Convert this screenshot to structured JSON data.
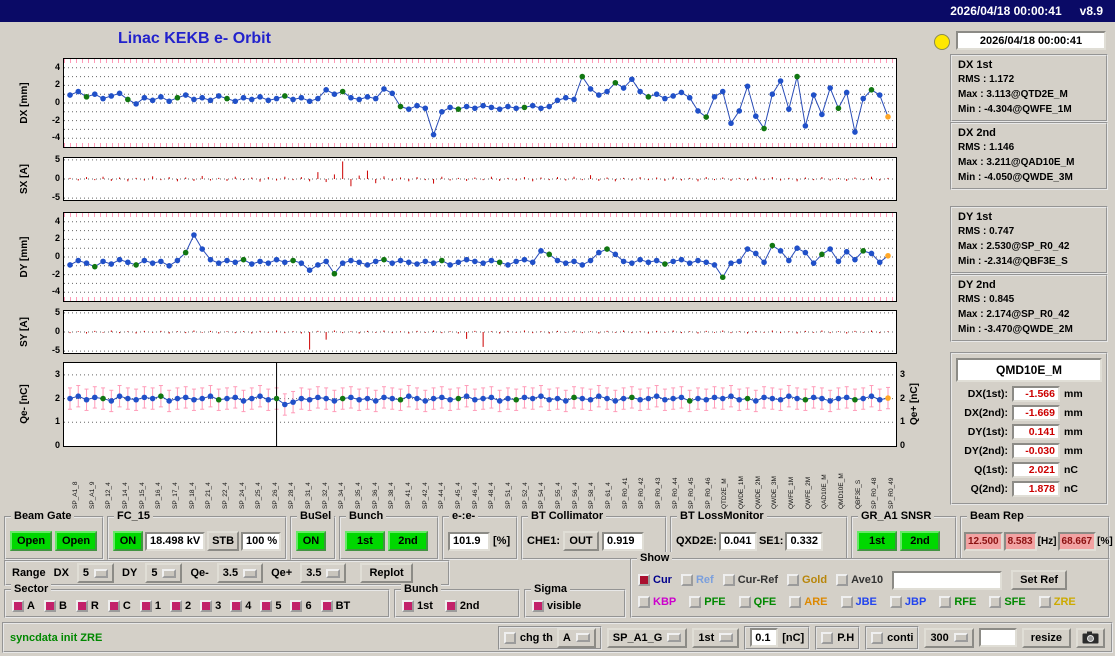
{
  "topbar": {
    "datetime": "2026/04/18 00:00:41",
    "version": "v8.9"
  },
  "title": "Linac KEKB e- Orbit",
  "status": {
    "timestamp": "2026/04/18 00:00:41",
    "stats": [
      {
        "name": "DX 1st",
        "lines": [
          "RMS : 1.172",
          "Max : 3.113@QTD2E_M",
          "Min : -4.304@QWFE_1M"
        ]
      },
      {
        "name": "DX 2nd",
        "lines": [
          "RMS : 1.146",
          "Max : 3.211@QAD10E_M",
          "Min : -4.050@QWDE_3M"
        ]
      },
      {
        "name": "DY 1st",
        "lines": [
          "RMS : 0.747",
          "Max : 2.530@SP_R0_42",
          "Min : -2.314@QBF3E_S"
        ]
      },
      {
        "name": "DY 2nd",
        "lines": [
          "RMS : 0.845",
          "Max : 2.174@SP_R0_42",
          "Min : -3.470@QWDE_2M"
        ]
      }
    ],
    "monitor": {
      "title": "QMD10E_M",
      "rows": [
        {
          "label": "DX(1st):",
          "value": "-1.566",
          "unit": "mm"
        },
        {
          "label": "DX(2nd):",
          "value": "-1.669",
          "unit": "mm"
        },
        {
          "label": "DY(1st):",
          "value": "0.141",
          "unit": "mm"
        },
        {
          "label": "DY(2nd):",
          "value": "-0.030",
          "unit": "mm"
        },
        {
          "label": "Q(1st):",
          "value": "2.021",
          "unit": "nC"
        },
        {
          "label": "Q(2nd):",
          "value": "1.878",
          "unit": "nC"
        }
      ]
    }
  },
  "chart_data": [
    {
      "type": "line",
      "ylabel": "DX [mm]",
      "ymin": -5,
      "ymax": 5,
      "ticks": [
        4,
        2,
        0,
        -2,
        -4
      ],
      "grid": [
        4,
        3,
        2,
        1,
        0,
        -1,
        -2,
        -3,
        -4
      ],
      "point_color": "#2050c8",
      "alt_point_color": "#117711",
      "line_color": "#2a4db8",
      "end_color": "#ffa726",
      "end_orange": true,
      "values": [
        0.9,
        1.3,
        0.7,
        1.0,
        0.5,
        0.8,
        1.1,
        0.4,
        -0.1,
        0.6,
        0.3,
        0.7,
        0.2,
        0.6,
        0.9,
        0.4,
        0.6,
        0.3,
        0.8,
        0.5,
        0.2,
        0.6,
        0.4,
        0.7,
        0.3,
        0.5,
        0.8,
        0.4,
        0.6,
        0.2,
        0.5,
        1.5,
        1.0,
        1.3,
        0.6,
        0.4,
        0.7,
        0.5,
        1.6,
        1.1,
        -0.4,
        -0.7,
        -0.3,
        -0.6,
        -3.6,
        -1.0,
        -0.5,
        -0.7,
        -0.4,
        -0.6,
        -0.3,
        -0.5,
        -0.7,
        -0.4,
        -0.6,
        -0.5,
        -0.3,
        -0.6,
        -0.4,
        0.3,
        0.6,
        0.4,
        3.0,
        1.6,
        0.9,
        1.3,
        2.3,
        1.7,
        2.7,
        1.3,
        0.7,
        1.0,
        0.5,
        0.8,
        1.2,
        0.6,
        -0.9,
        -1.6,
        0.7,
        1.3,
        -2.3,
        -0.9,
        1.9,
        -1.5,
        -2.9,
        1.0,
        2.5,
        -0.7,
        3.0,
        -2.6,
        0.9,
        -1.3,
        1.7,
        -0.6,
        1.2,
        -3.3,
        0.5,
        1.5,
        0.9,
        -1.57
      ],
      "green_indices": [
        2,
        7,
        13,
        19,
        26,
        33,
        40,
        47,
        55,
        62,
        66,
        70,
        77,
        84,
        88,
        93,
        97
      ]
    },
    {
      "type": "bar",
      "ylabel": "SX [A]",
      "ymin": -5.5,
      "ymax": 5.5,
      "ticks": [
        5,
        0,
        -5
      ],
      "grid": [
        5,
        0,
        -5
      ],
      "bar_color": "#cc0000",
      "values": [
        0.3,
        -0.4,
        0.5,
        -0.3,
        0.6,
        -0.5,
        0.4,
        -0.6,
        0.3,
        -0.4,
        0.7,
        -0.3,
        0.5,
        -0.6,
        0.4,
        -0.5,
        0.8,
        -0.4,
        0.3,
        -0.5,
        0.6,
        -0.3,
        0.4,
        -0.7,
        0.5,
        -0.4,
        0.6,
        -0.3,
        0.5,
        -0.6,
        1.8,
        -0.8,
        1.2,
        4.6,
        -1.9,
        0.9,
        2.2,
        -1.1,
        0.7,
        -0.5,
        0.4,
        -0.6,
        0.5,
        -0.3,
        -1.2,
        0.6,
        -0.4,
        0.3,
        -0.5,
        0.4,
        -0.3,
        0.6,
        -0.5,
        0.3,
        -0.4,
        0.5,
        -0.6,
        0.4,
        -0.3,
        0.5,
        -0.4,
        0.6,
        -0.3,
        1.0,
        -0.5,
        0.4,
        -0.6,
        0.3,
        -0.4,
        0.5,
        -0.3,
        0.4,
        -0.5,
        0.6,
        -0.4,
        0.3,
        -0.6,
        0.5,
        -0.3,
        0.4,
        -0.5,
        0.3,
        -0.4,
        0.6,
        -0.3,
        0.5,
        -0.4,
        0.3,
        -0.6,
        0.4,
        -0.3,
        0.5,
        -0.4,
        0.3,
        -0.5,
        0.4,
        -0.3,
        0.6,
        -0.4,
        0.3
      ]
    },
    {
      "type": "line",
      "ylabel": "DY [mm]",
      "ymin": -5,
      "ymax": 5,
      "ticks": [
        4,
        2,
        0,
        -2,
        -4
      ],
      "grid": [
        4,
        3,
        2,
        1,
        0,
        -1,
        -2,
        -3,
        -4
      ],
      "point_color": "#2050c8",
      "alt_point_color": "#117711",
      "line_color": "#2a4db8",
      "end_color": "#ffa726",
      "end_orange": true,
      "values": [
        -0.9,
        -0.4,
        -0.7,
        -1.1,
        -0.5,
        -0.8,
        -0.3,
        -0.6,
        -0.9,
        -0.4,
        -0.7,
        -0.5,
        -1.0,
        -0.4,
        0.5,
        2.5,
        0.9,
        -0.3,
        -0.7,
        -0.4,
        -0.6,
        -0.3,
        -0.8,
        -0.5,
        -0.7,
        -0.3,
        -0.6,
        -0.4,
        -0.7,
        -1.5,
        -0.9,
        -0.5,
        -1.9,
        -0.7,
        -0.4,
        -0.6,
        -0.9,
        -0.5,
        -0.3,
        -0.7,
        -0.4,
        -0.6,
        -0.8,
        -0.5,
        -0.7,
        -0.4,
        -0.9,
        -0.6,
        -0.3,
        -0.5,
        -0.7,
        -0.4,
        -0.6,
        -0.9,
        -0.5,
        -0.3,
        -0.6,
        0.7,
        0.3,
        -0.4,
        -0.7,
        -0.5,
        -0.9,
        -0.4,
        0.5,
        0.9,
        0.3,
        -0.5,
        -0.7,
        -0.3,
        -0.6,
        -0.4,
        -0.8,
        -0.5,
        -0.3,
        -0.7,
        -0.4,
        -0.6,
        -0.9,
        -2.3,
        -0.7,
        -0.5,
        0.9,
        0.4,
        -0.6,
        1.3,
        0.7,
        -0.4,
        1.0,
        0.5,
        -0.7,
        0.3,
        0.9,
        -0.5,
        0.6,
        -0.3,
        0.7,
        0.4,
        -0.6,
        0.14
      ],
      "green_indices": [
        3,
        8,
        14,
        21,
        27,
        32,
        38,
        45,
        52,
        58,
        65,
        72,
        79,
        85,
        91,
        96
      ]
    },
    {
      "type": "bar",
      "ylabel": "SY [A]",
      "ymin": -5.5,
      "ymax": 5.5,
      "ticks": [
        5,
        0,
        -5
      ],
      "grid": [
        5,
        0,
        -5
      ],
      "bar_color": "#cc0000",
      "values": [
        -0.3,
        0.2,
        -0.4,
        0.3,
        -0.2,
        0.4,
        -0.3,
        0.2,
        -0.4,
        0.3,
        -0.2,
        0.3,
        -0.4,
        0.2,
        -0.3,
        0.4,
        -0.2,
        0.3,
        -0.4,
        0.2,
        -0.3,
        0.2,
        -0.4,
        0.3,
        -0.2,
        0.4,
        -0.3,
        0.2,
        -0.4,
        -4.6,
        0.3,
        -2.0,
        0.4,
        -0.3,
        0.2,
        -0.4,
        0.3,
        -0.2,
        0.4,
        -0.3,
        0.2,
        -0.4,
        0.3,
        -0.2,
        0.4,
        -0.3,
        0.2,
        -0.4,
        -1.8,
        0.3,
        -3.9,
        0.2,
        -0.4,
        0.3,
        -0.2,
        0.4,
        -0.3,
        0.2,
        -0.4,
        0.3,
        -0.2,
        0.4,
        -0.3,
        0.2,
        -0.4,
        0.3,
        -0.2,
        0.4,
        -0.3,
        0.2,
        -0.4,
        0.3,
        -0.2,
        0.4,
        -0.3,
        0.2,
        -0.4,
        0.3,
        -0.2,
        0.4,
        -0.3,
        0.2,
        -0.4,
        0.3,
        -0.2,
        0.4,
        -0.3,
        0.2,
        -0.4,
        0.3,
        -0.2,
        0.4,
        -0.3,
        0.2,
        -0.4,
        0.3,
        -0.2,
        0.4,
        -0.3,
        0.2
      ]
    },
    {
      "type": "line",
      "ylabel": "Qe- [nC]",
      "ylabel_right": "Qe+ [nC]",
      "ymin": 0,
      "ymax": 3.5,
      "ticks": [
        3,
        2,
        1,
        0
      ],
      "ticks_right": [
        3,
        2,
        1,
        0
      ],
      "grid": [
        3,
        2,
        1
      ],
      "point_color": "#2050c8",
      "alt_point_color": "#117711",
      "line_color": "#2a4db8",
      "end_color": "#ffa726",
      "end_orange": true,
      "err": 0.45,
      "err_color": "#ff9bb8",
      "cursor_index": 25,
      "values": [
        2.0,
        2.1,
        1.95,
        2.05,
        2.0,
        1.9,
        2.1,
        2.0,
        1.95,
        2.05,
        2.0,
        2.1,
        1.9,
        2.0,
        2.05,
        1.95,
        2.0,
        2.1,
        1.95,
        2.0,
        2.05,
        1.9,
        2.0,
        2.1,
        1.95,
        2.0,
        1.75,
        1.85,
        2.0,
        1.95,
        2.05,
        2.0,
        1.9,
        2.0,
        2.05,
        1.95,
        2.0,
        1.9,
        2.05,
        2.0,
        1.95,
        2.1,
        2.0,
        1.9,
        2.0,
        2.05,
        1.95,
        2.0,
        2.1,
        1.95,
        2.0,
        2.05,
        1.9,
        2.0,
        1.95,
        2.05,
        2.0,
        2.1,
        1.95,
        2.0,
        1.9,
        2.05,
        2.0,
        1.95,
        2.1,
        2.0,
        1.9,
        2.0,
        2.05,
        1.95,
        2.0,
        2.1,
        1.95,
        2.0,
        2.05,
        1.9,
        2.0,
        1.95,
        2.05,
        2.0,
        2.1,
        1.95,
        2.0,
        1.9,
        2.05,
        2.0,
        1.95,
        2.1,
        2.0,
        1.95,
        2.05,
        2.0,
        1.9,
        2.0,
        2.05,
        1.95,
        2.0,
        2.1,
        1.95,
        2.02
      ],
      "green_indices": [
        4,
        11,
        18,
        25,
        33,
        40,
        47,
        54,
        61,
        68,
        75,
        82,
        89,
        95
      ],
      "x_tick_labels": [
        "SP_A1_8",
        "SP_A1_9",
        "SP_12_4",
        "SP_14_4",
        "SP_15_4",
        "SP_16_4",
        "SP_17_4",
        "SP_18_4",
        "SP_21_4",
        "SP_22_4",
        "SP_24_4",
        "SP_25_4",
        "SP_26_4",
        "SP_28_4",
        "SP_31_4",
        "SP_32_4",
        "SP_34_4",
        "SP_35_4",
        "SP_36_4",
        "SP_38_4",
        "SP_41_4",
        "SP_42_4",
        "SP_44_4",
        "SP_45_4",
        "SP_46_4",
        "SP_48_4",
        "SP_51_4",
        "SP_52_4",
        "SP_54_4",
        "SP_55_4",
        "SP_56_4",
        "SP_58_4",
        "SP_61_4",
        "SP_R0_41",
        "SP_R0_42",
        "SP_R0_43",
        "SP_R0_44",
        "SP_R0_45",
        "SP_R0_46",
        "QTD2E_M",
        "QWDE_1M",
        "QWDE_2M",
        "QWDE_3M",
        "QWFE_1M",
        "QWFE_2M",
        "QAD10E_M",
        "QMD10E_M",
        "QBF3E_S",
        "SP_R0_48",
        "SP_R0_49"
      ]
    }
  ],
  "panels": {
    "beam_gate": {
      "label": "Beam Gate",
      "open1": "Open",
      "open2": "Open"
    },
    "fc15": {
      "label": "FC_15",
      "on": "ON",
      "kv": "18.498 kV",
      "stb": "STB",
      "pct": "100 %"
    },
    "busel": {
      "label": "BuSel",
      "on": "ON"
    },
    "bunch": {
      "label": "Bunch",
      "b1": "1st",
      "b2": "2nd"
    },
    "ee": {
      "label": "e-:e-",
      "value": "101.9",
      "unit": "[%]"
    },
    "bt_col": {
      "label": "BT Collimator",
      "che1": "CHE1:",
      "out": "OUT",
      "value": "0.919"
    },
    "bt_loss": {
      "label": "BT LossMonitor",
      "qxd2e": "QXD2E:",
      "qxd2e_value": "0.041",
      "se1": "SE1:",
      "se1_value": "0.332"
    },
    "gr_a1": {
      "label": "GR_A1 SNSR",
      "b1": "1st",
      "b2": "2nd"
    },
    "beam_rep": {
      "label": "Beam Rep",
      "v1": "12.500",
      "v2": "8.583",
      "hz": "[Hz]",
      "v3": "68.667",
      "pct": "[%]"
    }
  },
  "range": {
    "label": "Range",
    "dx_label": "DX",
    "dx": "5",
    "dy_label": "DY",
    "dy": "5",
    "qem_label": "Qe-",
    "qem": "3.5",
    "qep_label": "Qe+",
    "qep": "3.5",
    "replot": "Replot"
  },
  "groups": {
    "sector": {
      "label": "Sector",
      "items": [
        "A",
        "B",
        "R",
        "C",
        "1",
        "2",
        "3",
        "4",
        "5",
        "6",
        "BT"
      ]
    },
    "bunch": {
      "label": "Bunch",
      "items": [
        "1st",
        "2nd"
      ]
    },
    "sigma": {
      "label": "Sigma",
      "items": [
        "visible"
      ]
    }
  },
  "show": {
    "label": "Show",
    "row1": [
      {
        "label": "Cur",
        "color": "#00008b",
        "checked": true,
        "check_color": "#aa1030"
      },
      {
        "label": "Ref",
        "color": "#7b9fdd"
      },
      {
        "label": "Cur-Ref",
        "color": "#333333"
      },
      {
        "label": "Gold",
        "color": "#b8860b"
      },
      {
        "label": "Ave10",
        "color": "#333333"
      }
    ],
    "ref_input_value": "",
    "set_ref_label": "Set Ref",
    "row2": [
      {
        "label": "KBP",
        "color": "#cc00cc"
      },
      {
        "label": "PFE",
        "color": "#008800"
      },
      {
        "label": "QFE",
        "color": "#008800"
      },
      {
        "label": "ARE",
        "color": "#dd8800"
      },
      {
        "label": "JBE",
        "color": "#2244ee"
      },
      {
        "label": "JBP",
        "color": "#2244ee"
      },
      {
        "label": "RFE",
        "color": "#008800"
      },
      {
        "label": "SFE",
        "color": "#008800"
      },
      {
        "label": "ZRE",
        "color": "#ccaa00"
      }
    ]
  },
  "status_message": "syncdata init ZRE",
  "bottom_bar": {
    "chg_th_label": "chg th",
    "thresh_select": "A",
    "device_select": "SP_A1_G",
    "bunch_select": "1st",
    "thresh_value": "0.1",
    "thresh_unit": "[nC]",
    "ph_label": "P.H",
    "conti_label": "conti",
    "points_select": "300",
    "blank_value": "",
    "resize_label": "resize"
  }
}
